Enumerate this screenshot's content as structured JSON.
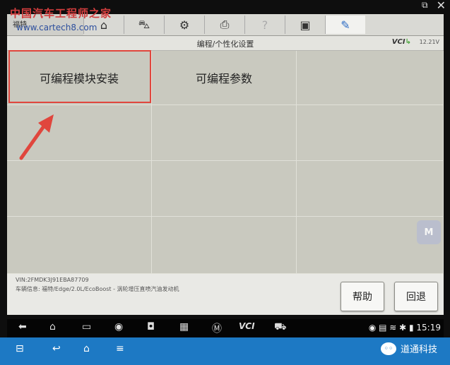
{
  "toolbar": {
    "brand": "福特",
    "watermark_cn": "中国汽车工程师之家",
    "watermark_url": "www.cartech8.com",
    "icons": [
      "home-icon",
      "car-lift-icon",
      "gear-icon",
      "printer-icon",
      "help-icon",
      "save-icon",
      "pen-icon"
    ]
  },
  "subbar": {
    "title": "编程/个性化设置",
    "vci": "VCI",
    "battery": "12.21V"
  },
  "grid": {
    "items": [
      "可编程模块安装",
      "可编程参数",
      "",
      "",
      "",
      "",
      "",
      "",
      "",
      "",
      "",
      ""
    ]
  },
  "float_button": "M",
  "info": {
    "vin": "VIN:2FMDK3J91EBA87709",
    "vehicle": "车辆信息: 福特/Edge/2.0L/EcoBoost - 涡轮增压直喷汽油发动机"
  },
  "buttons": {
    "help": "帮助",
    "back": "回退"
  },
  "navbar": {
    "time": "15:19",
    "vci": "VCI"
  },
  "wechat": {
    "name": "道通科技"
  },
  "colors": {
    "highlight": "#e0463d",
    "bottom_bar": "#1d79c4"
  }
}
